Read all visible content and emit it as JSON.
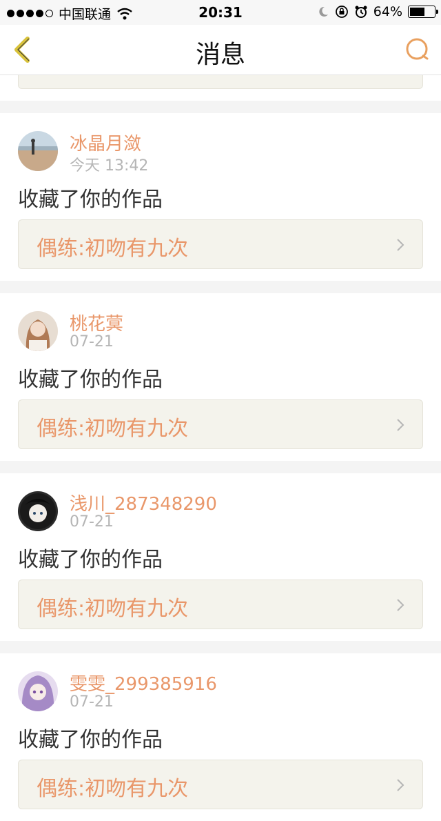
{
  "status_bar": {
    "carrier": "中国联通",
    "time": "20:31",
    "battery_percent": "64%",
    "battery_level": 0.64,
    "signal_bars_filled": 4,
    "signal_bars_total": 5,
    "icons": [
      "wifi-icon",
      "moon-icon",
      "rotation-lock-icon",
      "alarm-icon",
      "battery-icon"
    ]
  },
  "nav": {
    "title": "消息",
    "back_icon": "chevron-left-icon",
    "search_icon": "search-icon",
    "accent_color": "#e9a05f",
    "back_color": "#d8c23a"
  },
  "messages": [
    {
      "username": "冰晶月潋",
      "time": "今天 13:42",
      "action": "收藏了你的作品",
      "work_title": "偶练:初吻有九次",
      "avatar": "beach-photo-avatar"
    },
    {
      "username": "桃花蓂",
      "time": "07-21",
      "action": "收藏了你的作品",
      "work_title": "偶练:初吻有九次",
      "avatar": "girl-photo-avatar"
    },
    {
      "username": "浅川_287348290",
      "time": "07-21",
      "action": "收藏了你的作品",
      "work_title": "偶练:初吻有九次",
      "avatar": "dark-anime-avatar"
    },
    {
      "username": "雯雯_299385916",
      "time": "07-21",
      "action": "收藏了你的作品",
      "work_title": "偶练:初吻有九次",
      "avatar": "purple-anime-avatar"
    }
  ],
  "colors": {
    "username": "#e9976a",
    "work_title": "#e9976a",
    "timestamp": "#b5b5b5",
    "work_box_bg": "#f4f3ec"
  }
}
